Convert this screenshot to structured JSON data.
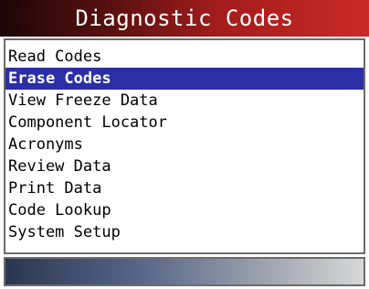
{
  "header": {
    "title": "Diagnostic Codes"
  },
  "menu": {
    "selected_index": 1,
    "items": [
      {
        "label": "Read Codes"
      },
      {
        "label": "Erase Codes"
      },
      {
        "label": "View Freeze Data"
      },
      {
        "label": "Component Locator"
      },
      {
        "label": "Acronyms"
      },
      {
        "label": "Review Data"
      },
      {
        "label": "Print Data"
      },
      {
        "label": "Code Lookup"
      },
      {
        "label": "System Setup"
      }
    ]
  },
  "colors": {
    "title_bar": "#a51c1c",
    "selection": "#2b2fa6",
    "status_bar": "#5a6a8a"
  }
}
